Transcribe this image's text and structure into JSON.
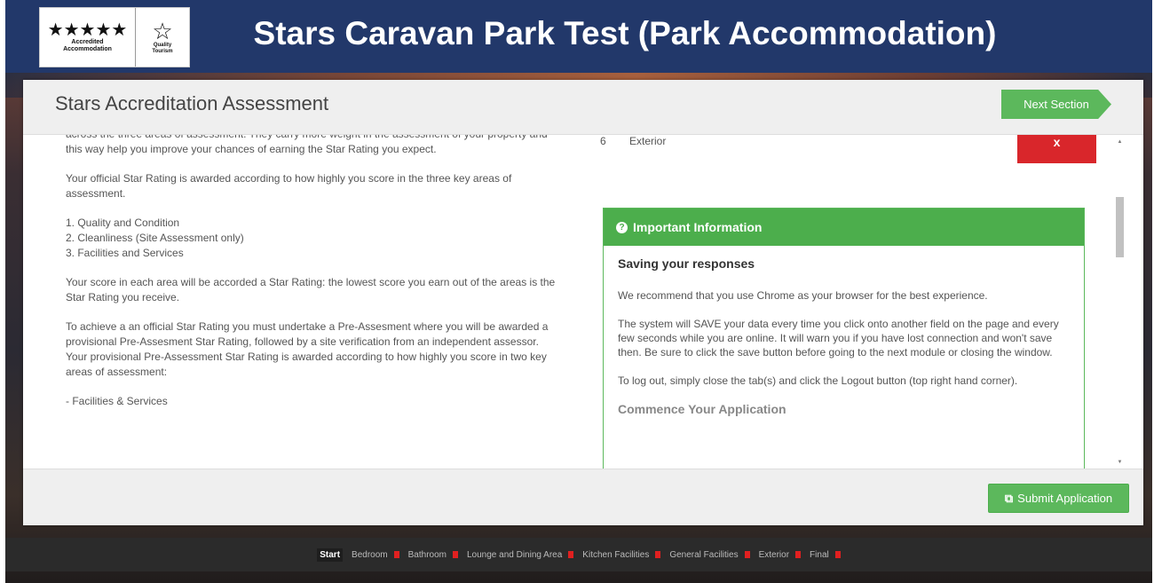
{
  "header": {
    "title": "Stars Caravan Park Test (Park Accommodation)",
    "logo": {
      "stars": "★★★★★",
      "accredited": "Accredited",
      "accommodation": "Accommodation",
      "qt_star": "☆",
      "qt_line1": "Quality",
      "qt_line2": "Tourism"
    }
  },
  "panel": {
    "title": "Stars Accreditation Assessment",
    "next_label": "Next Section"
  },
  "left": {
    "p1": "across the three areas of assessment. They carry more weight in the assessment of your property and this way help you improve your chances of earning the Star Rating you expect.",
    "p2": "Your official Star Rating is awarded according to how highly you score in the three key areas of assessment.",
    "list": [
      "1. Quality and Condition",
      "2. Cleanliness (Site Assessment only)",
      "3. Facilities and Services"
    ],
    "p3": "Your score in each area will be accorded a Star Rating: the lowest score you earn out of the areas is the Star Rating you receive.",
    "p4": "To achieve a an official Star Rating you must undertake a Pre-Assesment where you will be awarded a provisional Pre-Assesment Star Rating, followed by a site verification from an independent assessor. Your provisional Pre-Assessment Star Rating is awarded according to how highly you score in two key areas of assessment:",
    "p5": "- Facilities & Services"
  },
  "right": {
    "row_num": "6",
    "row_label": "Exterior",
    "delete_label": "x",
    "info": {
      "icon": "?",
      "title": "Important Information",
      "heading": "Saving your responses",
      "p1": "We recommend that you use Chrome as your browser for the best experience.",
      "p2": "The system will SAVE your data every time you click onto another field on the page and every few seconds while you are online. It will warn you if you have lost connection and won't save then. Be sure to click the save button before going to the next module or closing the window.",
      "p3": "To log out, simply close the tab(s) and click the Logout button (top right hand corner).",
      "p4": "Commence Your Application"
    }
  },
  "footer": {
    "submit_label": "Submit Application",
    "submit_icon": "⧉"
  },
  "nav": {
    "items": [
      {
        "label": "Start",
        "active": true
      },
      {
        "label": "Bedroom"
      },
      {
        "label": "Bathroom"
      },
      {
        "label": "Lounge and Dining Area"
      },
      {
        "label": "Kitchen Facilities"
      },
      {
        "label": "General Facilities"
      },
      {
        "label": "Exterior"
      },
      {
        "label": "Final"
      }
    ]
  },
  "colors": {
    "header_bg": "#22386a",
    "success": "#5cb85c",
    "danger": "#d9262b",
    "incomplete_marker": "#e02020"
  }
}
